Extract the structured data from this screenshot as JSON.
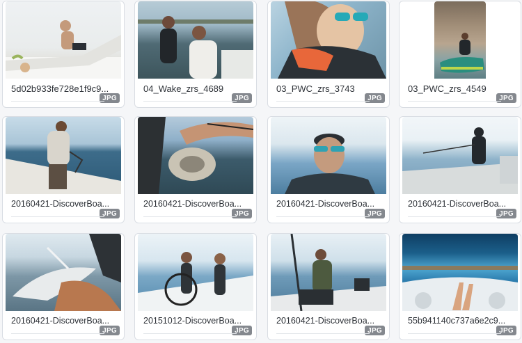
{
  "gallery": {
    "items": [
      {
        "name": "5d02b933fe728e1f9c9...",
        "badge": "JPG",
        "colors": [
          "#f2f4f5",
          "#d7d2c8",
          "#e9ecec"
        ]
      },
      {
        "name": "04_Wake_zrs_4689",
        "badge": "JPG",
        "colors": [
          "#9fb9c7",
          "#3c4b52",
          "#f0efe9"
        ]
      },
      {
        "name": "03_PWC_zrs_3743",
        "badge": "JPG",
        "colors": [
          "#8fb6cc",
          "#e2c3a5",
          "#2b3136"
        ]
      },
      {
        "name": "03_PWC_zrs_4549",
        "badge": "JPG",
        "colors": [
          "#8a7a66",
          "#b7a38c",
          "#2f5b55"
        ]
      },
      {
        "name": "20160421-DiscoverBoa...",
        "badge": "JPG",
        "colors": [
          "#a9c5d7",
          "#3d6c8a",
          "#e8e6e0"
        ]
      },
      {
        "name": "20160421-DiscoverBoa...",
        "badge": "JPG",
        "colors": [
          "#8fb0c9",
          "#3c5b6b",
          "#c9c3b4"
        ]
      },
      {
        "name": "20160421-DiscoverBoa...",
        "badge": "JPG",
        "colors": [
          "#dbe7ee",
          "#7aa6c6",
          "#2f3a42"
        ]
      },
      {
        "name": "20160421-DiscoverBoa...",
        "badge": "JPG",
        "colors": [
          "#e9f1f5",
          "#6c95b3",
          "#2b3137"
        ]
      },
      {
        "name": "20160421-DiscoverBoa...",
        "badge": "JPG",
        "colors": [
          "#c7d7e1",
          "#5a7585",
          "#e8ebec"
        ]
      },
      {
        "name": "20151012-DiscoverBoa...",
        "badge": "JPG",
        "colors": [
          "#d7e6ef",
          "#7ba8c6",
          "#2f3438"
        ]
      },
      {
        "name": "20160421-DiscoverBoa...",
        "badge": "JPG",
        "colors": [
          "#cfe0ea",
          "#6f9bb9",
          "#2a2f33"
        ]
      },
      {
        "name": "55b941140c737a6e2c9...",
        "badge": "JPG",
        "colors": [
          "#1b5f8a",
          "#4ea6d0",
          "#e9eef1"
        ]
      }
    ]
  }
}
